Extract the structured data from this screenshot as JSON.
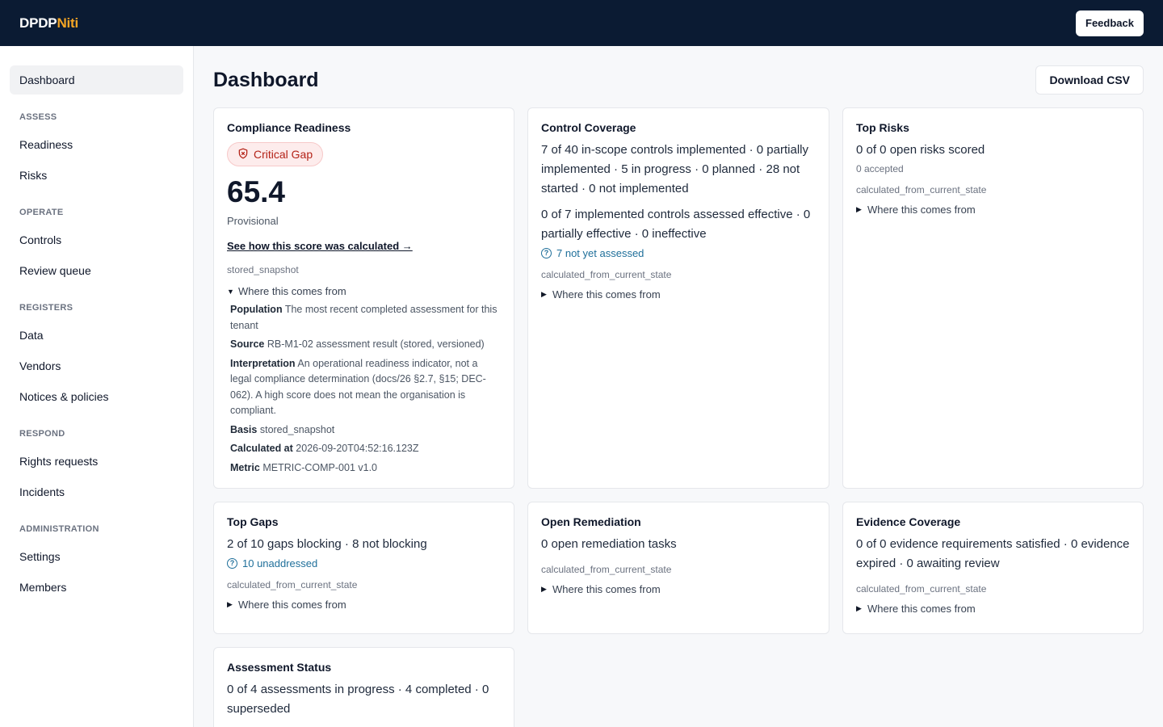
{
  "app": {
    "brand_primary": "DPDP",
    "brand_accent": "Niti",
    "feedback_label": "Feedback"
  },
  "sidebar": {
    "dashboard": "Dashboard",
    "sections": {
      "assess": "ASSESS",
      "operate": "OPERATE",
      "registers": "REGISTERS",
      "respond": "RESPOND",
      "administration": "ADMINISTRATION"
    },
    "items": {
      "readiness": "Readiness",
      "risks": "Risks",
      "controls": "Controls",
      "review_queue": "Review queue",
      "data": "Data",
      "vendors": "Vendors",
      "notices": "Notices & policies",
      "rights_requests": "Rights requests",
      "incidents": "Incidents",
      "settings": "Settings",
      "members": "Members"
    }
  },
  "page": {
    "title": "Dashboard",
    "download_label": "Download CSV"
  },
  "common": {
    "where_label": "Where this comes from",
    "basis_current": "calculated_from_current_state"
  },
  "compliance": {
    "title": "Compliance Readiness",
    "badge": "Critical Gap",
    "score": "65.4",
    "status": "Provisional",
    "link": "See how this score was calculated →",
    "basis": "stored_snapshot",
    "details": {
      "population_k": "Population",
      "population_v": "The most recent completed assessment for this tenant",
      "source_k": "Source",
      "source_v": "RB-M1-02 assessment result (stored, versioned)",
      "interpretation_k": "Interpretation",
      "interpretation_v": "An operational readiness indicator, not a legal compliance determination (docs/26 §2.7, §15; DEC-062). A high score does not mean the organisation is compliant.",
      "basis_k": "Basis",
      "basis_v": "stored_snapshot",
      "calculated_k": "Calculated at",
      "calculated_v": "2026-09-20T04:52:16.123Z",
      "metric_k": "Metric",
      "metric_v": "METRIC-COMP-001 v1.0"
    }
  },
  "control_coverage": {
    "title": "Control Coverage",
    "line1": "7 of 40 in-scope controls implemented · 0 partially implemented · 5 in progress · 0 planned · 28 not started · 0 not implemented",
    "line2": "0 of 7 implemented controls assessed effective · 0 partially effective · 0 ineffective",
    "info": "7 not yet assessed"
  },
  "top_risks": {
    "title": "Top Risks",
    "line1": "0 of 0 open risks scored",
    "sub": "0 accepted"
  },
  "top_gaps": {
    "title": "Top Gaps",
    "line1": "2 of 10 gaps blocking · 8 not blocking",
    "info": "10 unaddressed"
  },
  "open_remediation": {
    "title": "Open Remediation",
    "line1": "0 open remediation tasks"
  },
  "evidence_coverage": {
    "title": "Evidence Coverage",
    "line1": "0 of 0 evidence requirements satisfied · 0 evidence expired · 0 awaiting review"
  },
  "assessment_status": {
    "title": "Assessment Status",
    "line1": "0 of 4 assessments in progress · 4 completed · 0 superseded"
  },
  "colors": {
    "topbar": "#0b1b33",
    "brand_accent": "#f5a524",
    "critical": "#b42318",
    "info": "#1f6f9a"
  },
  "icons": {
    "badge": "shield-alert-icon",
    "info": "question-circle-icon",
    "collapsed": "triangle-right-icon",
    "expanded": "triangle-down-icon"
  }
}
